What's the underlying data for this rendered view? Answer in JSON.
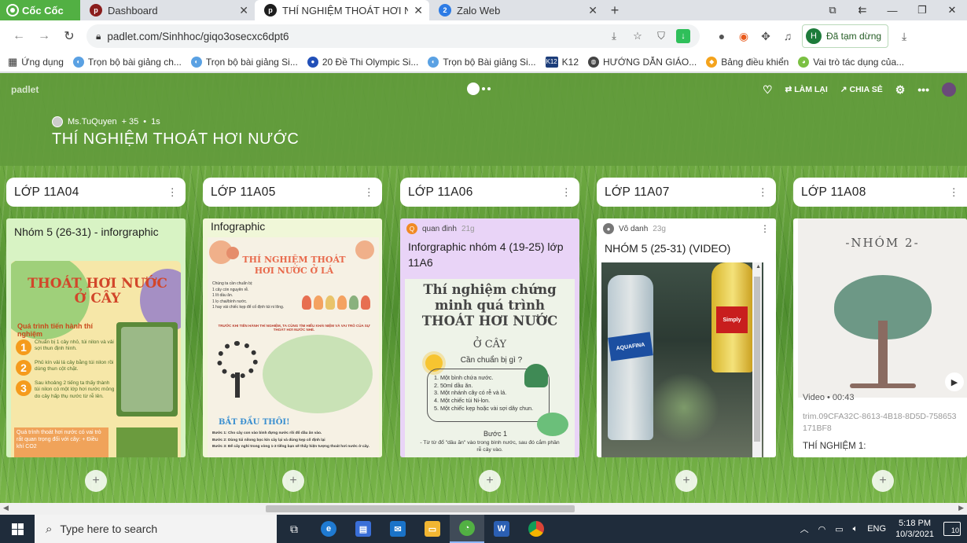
{
  "browser": {
    "brand": "Cốc Cốc",
    "tabs": [
      {
        "title": "Dashboard",
        "favicon": "padlet-icon",
        "active": false
      },
      {
        "title": "THÍ NGHIỆM THOÁT HƠI NƯ",
        "favicon": "padlet-icon",
        "active": true
      },
      {
        "title": "Zalo Web",
        "favicon": "zalo-icon",
        "badge": "2",
        "active": false
      }
    ],
    "url": "padlet.com/Sinhhoc/giqo3osecxc6dpt6",
    "profile": {
      "initial": "H",
      "status": "Đã tạm dừng"
    },
    "bookmarks": [
      "Ứng dụng",
      "Trọn bộ bài giảng ch...",
      "Trọn bộ bài giảng Si...",
      "20 Đề Thi Olympic Si...",
      "Trọn bộ Bài giảng Si...",
      "K12",
      "HƯỚNG DẪN GIÁO...",
      "Bảng điều khiển",
      "Vai trò tác dụng của..."
    ]
  },
  "padlet": {
    "logo": "padlet",
    "actions": {
      "remake": "LÀM LẠI",
      "share": "CHIA SẺ"
    },
    "author": "Ms.TuQuyen",
    "likes": "+ 35",
    "time": "1s",
    "title": "THÍ NGHIỆM THOÁT HƠI NƯỚC",
    "columns": [
      {
        "header": "LỚP 11A04",
        "card": {
          "title": "Nhóm 5 (26-31) - inforgraphic",
          "image": {
            "heading": "THOÁT HƠI NƯỚC Ở CÂY",
            "subheading": "Quá trình tiến hành thí nghiệm",
            "steps": [
              {
                "n": "1",
                "text": "Chuẩn bị 1 cây nhỏ, túi nilon và vải sợi thun định hình."
              },
              {
                "n": "2",
                "text": "Phủ kín vải lá cây bằng túi nilon rồi dùng thun cột chặt."
              },
              {
                "n": "3",
                "text": "Sau khoảng 2 tiếng ta thấy thành túi nilon có một lớp hơi nước mỏng do cây hấp thụ nước từ rễ lên."
              }
            ],
            "footer": "Quá trình thoát hơi nước có vai trò rất quan trọng đối với cây: + Điều khí CO2"
          }
        }
      },
      {
        "header": "LỚP 11A05",
        "card": {
          "title": "Infographic",
          "image": {
            "heading": "THÍ NGHIỆM THOÁT HƠI NƯỚC Ở LÁ",
            "prep_title": "Chúng ta cần chuẩn bị:",
            "prep": [
              "1 cây còn nguyên rễ.",
              "1 lít dầu ăn.",
              "1 lọ chai/bình nước.",
              "1 hay vài chiếc kẹp để cố định túi ni lông."
            ],
            "intro": "TRƯỚC KHI TIẾN HÀNH THÍ NGHIỆM, TA CÙNG TÌM HIỂU KHÁI NIỆM VÀ VAI TRÒ CỦA SỰ THOÁT HƠI NƯỚC NHÉ.",
            "start": "BẮT ĐẦU THÔI!",
            "steps": [
              "Bước 1: Cho cây con vào bình đựng nước rồi đổ dầu ăn vào.",
              "Bước 2: Dùng túi nilong bọc kín cây lại và dùng kẹp cố định lại",
              "Bước 3: Để cây nghỉ trong vòng 1-3 tiếng bạn sẽ thấy hiện tượng thoát hơi nước ở cây."
            ]
          }
        }
      },
      {
        "header": "LỚP 11A06",
        "card": {
          "author": "quan đinh",
          "author_initial": "Q",
          "time": "21g",
          "title": "Inforgraphic nhóm 4 (19-25) lớp 11A6",
          "image": {
            "heading": "Thí nghiệm chứng minh quá trình THOÁT HƠI NƯỚC",
            "subheading": "Ở CÂY",
            "prep_title": "Cần chuẩn bị gì ?",
            "prep": [
              "1. Một bình chứa nước.",
              "2. 50ml dầu ăn.",
              "3. Một nhánh cây có rễ và lá.",
              "4. Một chiếc túi Ni-lon.",
              "5. Một chiếc kẹp hoặc vài sợi dây chun."
            ],
            "step_title": "Bước 1",
            "step_text": "- Từ từ đổ \"dầu ăn\" vào trong bình nước, sau đó cắm phần rễ cây vào."
          }
        }
      },
      {
        "header": "LỚP 11A07",
        "card": {
          "author": "Vô danh",
          "time": "23g",
          "title": "NHÓM 5 (25-31) (VIDEO)",
          "image": {
            "bottle_label": "AQUAFINA",
            "oil_label": "Simply"
          }
        }
      },
      {
        "header": "LỚP 11A08",
        "card": {
          "image": {
            "heading": "-NHÓM 2-"
          },
          "video_label": "Video",
          "duration": "00:43",
          "filename": "trim.09CFA32C-8613-4B18-8D5D-758653171BF8",
          "caption": "THÍ NGHIỆM 1:"
        }
      }
    ]
  },
  "taskbar": {
    "search_placeholder": "Type here to search",
    "language": "ENG",
    "time": "5:18 PM",
    "date": "10/3/2021",
    "notifications": "10"
  },
  "colors": {
    "brand_green": "#52b043",
    "padlet_header": "#629b3c",
    "card_a04": "#d8f3c4",
    "card_a05": "#f0f7d8",
    "card_a06": "#e9d4f7",
    "taskbar": "#1f2c3b"
  }
}
